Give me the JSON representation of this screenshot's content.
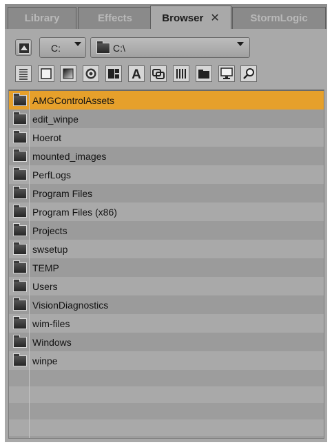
{
  "tabs": [
    {
      "label": "Library"
    },
    {
      "label": "Effects"
    },
    {
      "label": "Browser",
      "close": "✕"
    },
    {
      "label": "StormLogic"
    }
  ],
  "drive": {
    "selected": "C:"
  },
  "path": {
    "value": "C:\\"
  },
  "toolbar": {
    "icons": [
      "list-view-icon",
      "square-icon",
      "gradient-icon",
      "disc-icon",
      "split-view-icon",
      "text-icon",
      "link-icon",
      "columns-icon",
      "folder-icon",
      "monitor-icon",
      "search-icon"
    ],
    "text_icon_glyph": "A"
  },
  "files": [
    {
      "name": "AMGControlAssets",
      "selected": true
    },
    {
      "name": "edit_winpe"
    },
    {
      "name": "Hoerot"
    },
    {
      "name": "mounted_images"
    },
    {
      "name": "PerfLogs"
    },
    {
      "name": "Program Files"
    },
    {
      "name": "Program Files (x86)"
    },
    {
      "name": "Projects"
    },
    {
      "name": "swsetup"
    },
    {
      "name": "TEMP"
    },
    {
      "name": "Users"
    },
    {
      "name": "VisionDiagnostics"
    },
    {
      "name": "wim-files"
    },
    {
      "name": "Windows"
    },
    {
      "name": "winpe"
    }
  ],
  "colors": {
    "selection": "#e6a02b",
    "panel": "#a9a9a9",
    "tabbar": "#8e8e8e"
  }
}
